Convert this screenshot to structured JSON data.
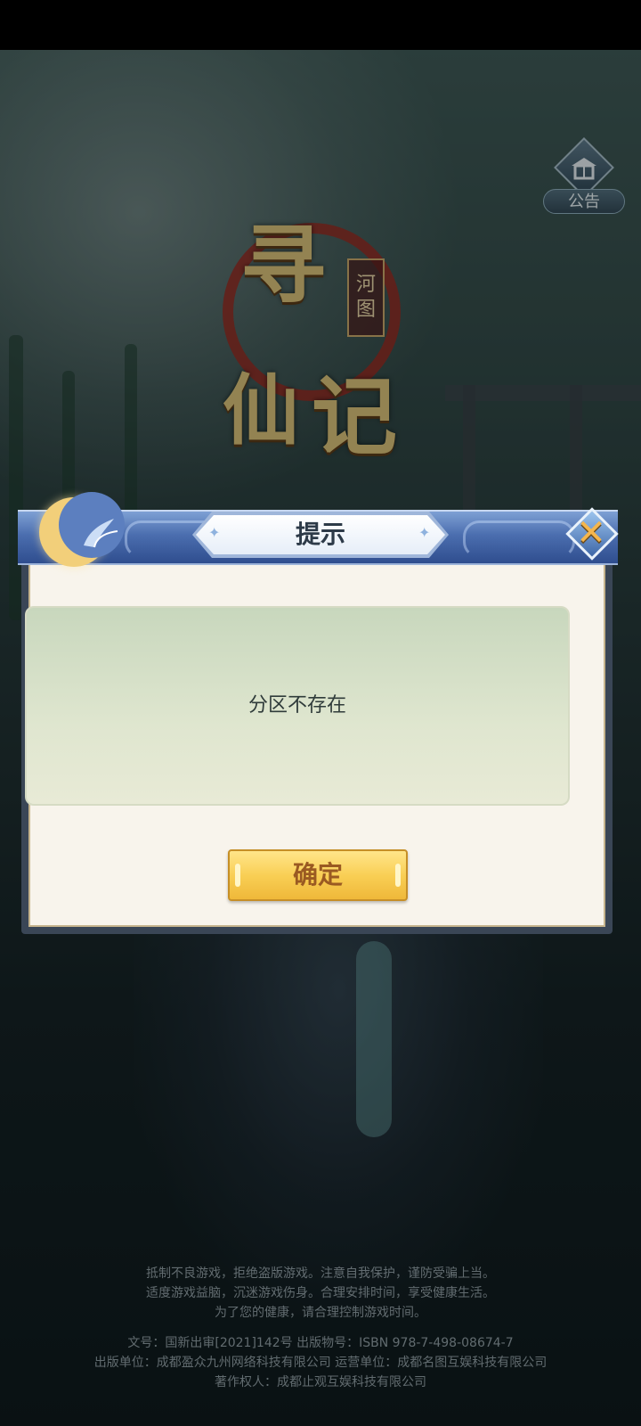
{
  "notice": {
    "label": "公告",
    "icon": "notice-board-icon"
  },
  "logo": {
    "char1": "寻",
    "char2": "仙",
    "char3": "记",
    "seal": [
      "河",
      "图"
    ]
  },
  "dialog": {
    "title": "提示",
    "message": "分区不存在",
    "confirm_label": "确定",
    "close_icon": "close-icon"
  },
  "footer": {
    "health_lines": [
      "抵制不良游戏，拒绝盗版游戏。注意自我保护，谨防受骗上当。",
      "适度游戏益脑，沉迷游戏伤身。合理安排时间，享受健康生活。",
      "为了您的健康，请合理控制游戏时间。"
    ],
    "license_lines": [
      "文号：国新出审[2021]142号  出版物号：ISBN 978-7-498-08674-7",
      "出版单位：成都盈众九州网络科技有限公司  运营单位：成都名图互娱科技有限公司",
      "著作权人：成都止观互娱科技有限公司"
    ]
  },
  "colors": {
    "accent_blue": "#4b6eaf",
    "button_gold": "#f9cf55",
    "panel_green": "#c8d7bd"
  }
}
